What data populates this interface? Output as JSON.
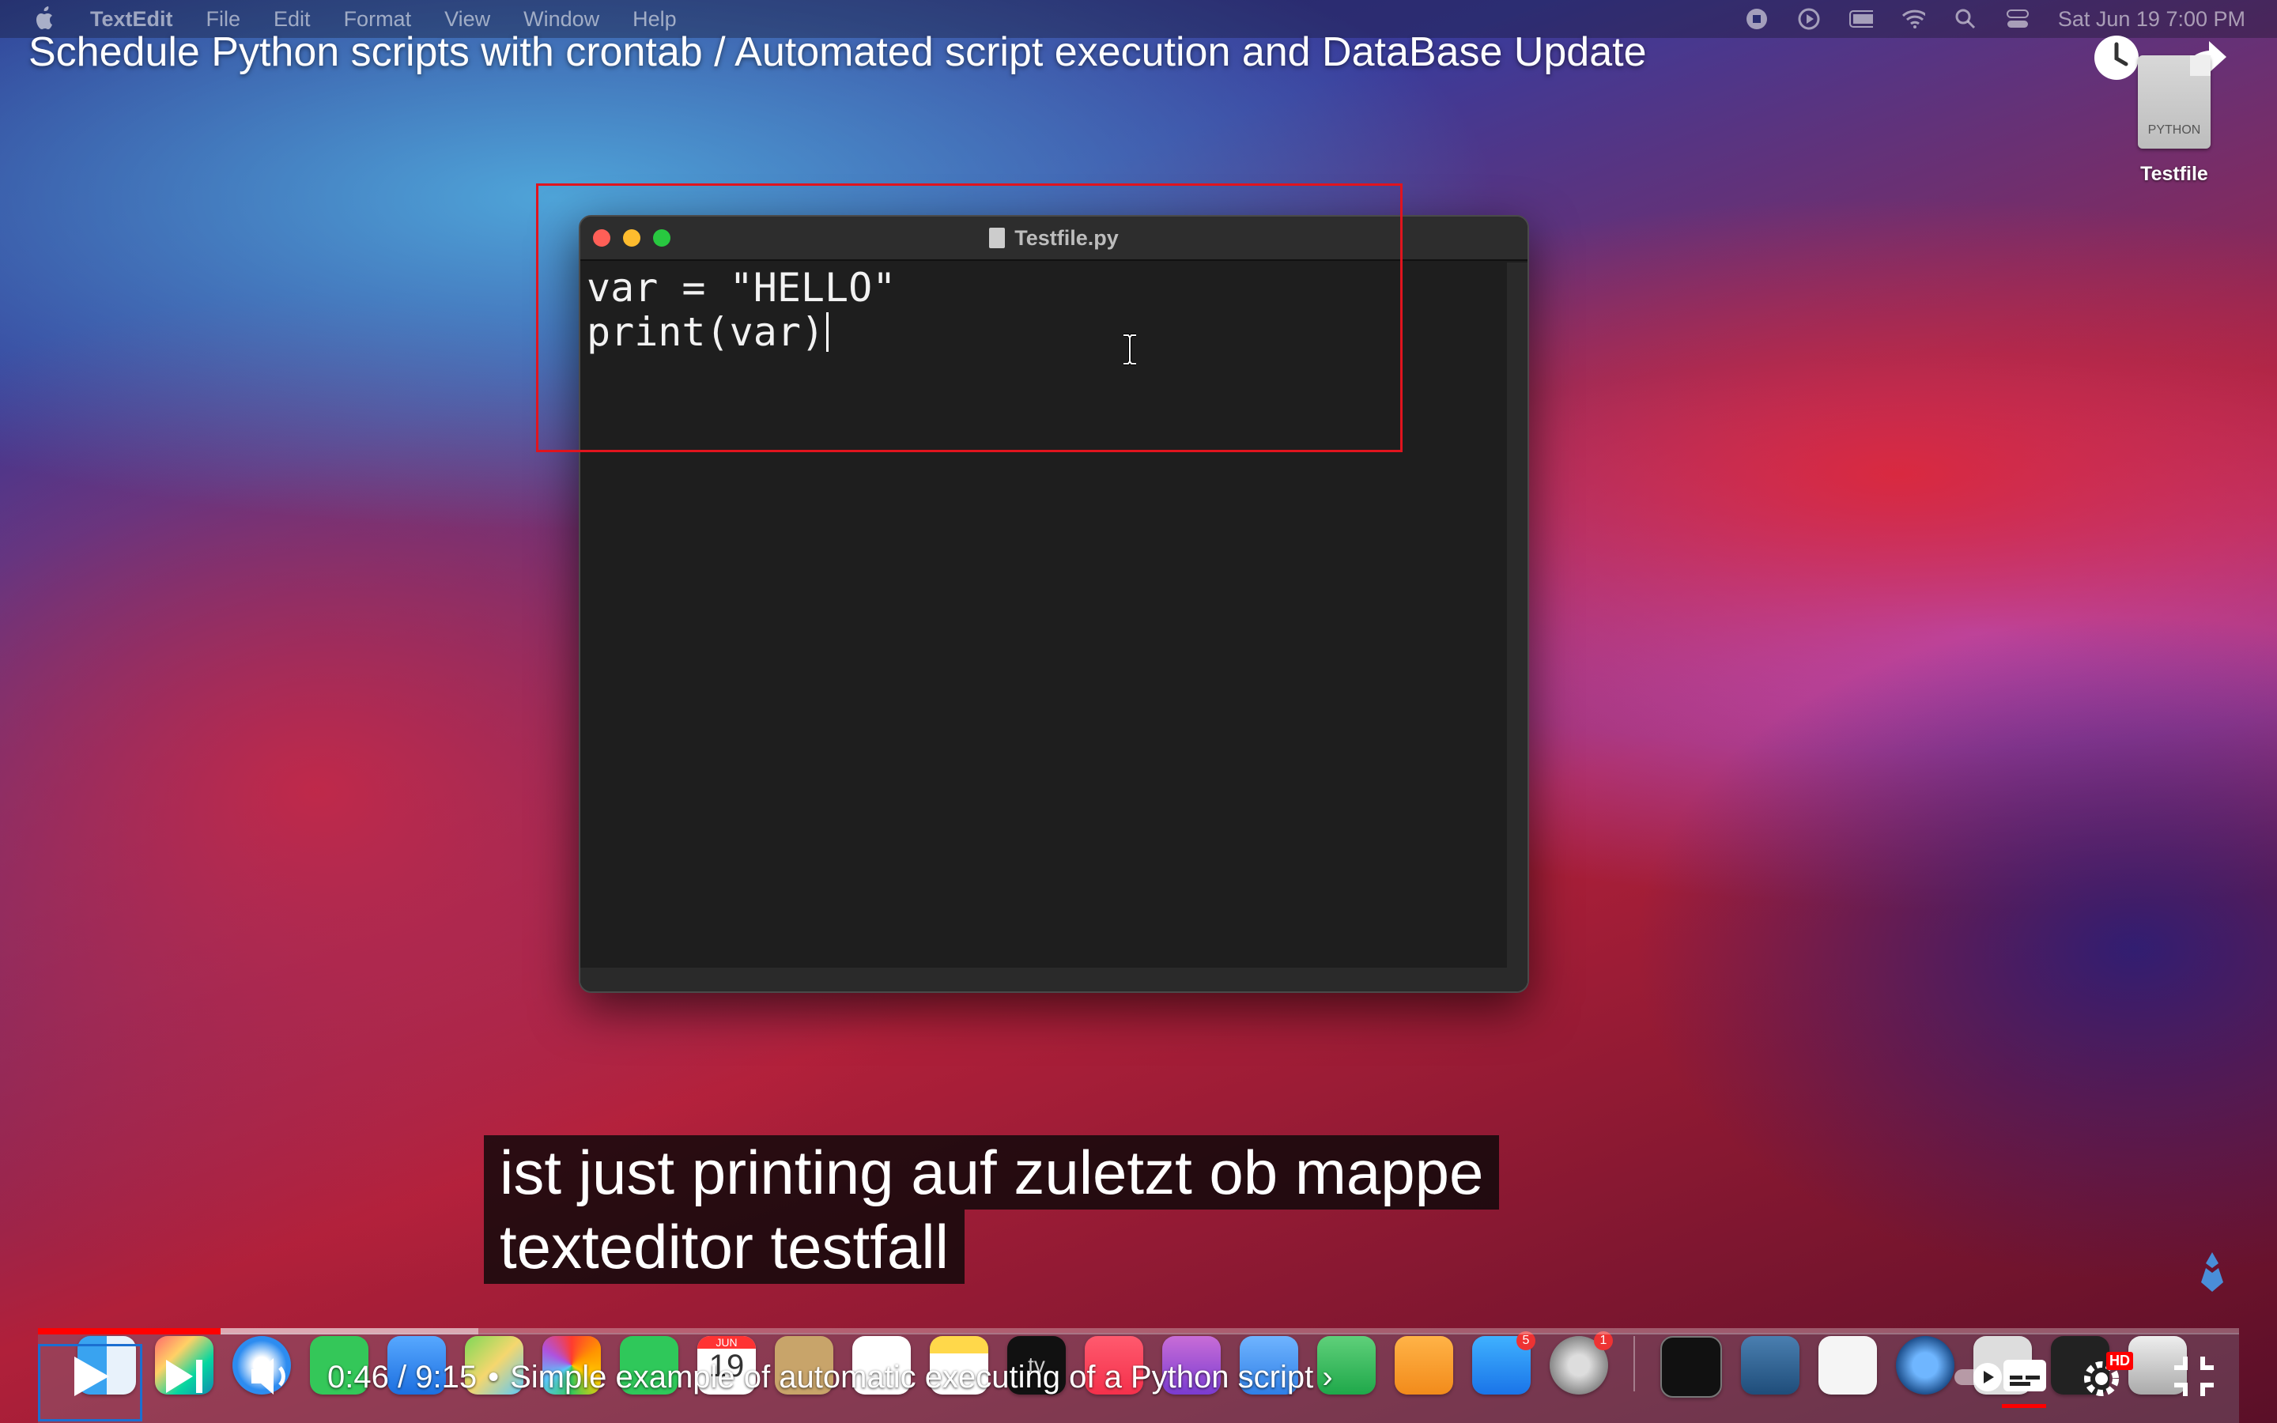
{
  "menubar": {
    "app_name": "TextEdit",
    "items": [
      "File",
      "Edit",
      "Format",
      "View",
      "Window",
      "Help"
    ],
    "clock": "Sat Jun 19  7:00 PM"
  },
  "video": {
    "title": "Schedule Python scripts with crontab / Automated script execution and DataBase Update",
    "current_time": "0:46",
    "duration": "9:15",
    "time_separator": "/",
    "chapter": "Simple example of automatic executing of a Python script",
    "chapter_chevron": "›",
    "progress_fraction": 0.083,
    "buffer_fraction": 0.2,
    "hd_badge": "HD"
  },
  "subtitles": [
    "ist just printing auf zuletzt ob mappe",
    "texteditor testfall"
  ],
  "window": {
    "title": "Testfile.py",
    "code_lines": [
      "var = \"HELLO\"",
      "print(var)"
    ]
  },
  "desktop": {
    "file_name": "Testfile",
    "file_type_label": "PYTHON"
  },
  "dock": {
    "calendar_month": "JUN",
    "calendar_day": "19",
    "tv_label": "tv",
    "app_store_badge": "5",
    "settings_badge": "1"
  },
  "colors": {
    "highlight": "#e0141e",
    "progress": "#ff0000",
    "focus": "#1b6fd1"
  }
}
